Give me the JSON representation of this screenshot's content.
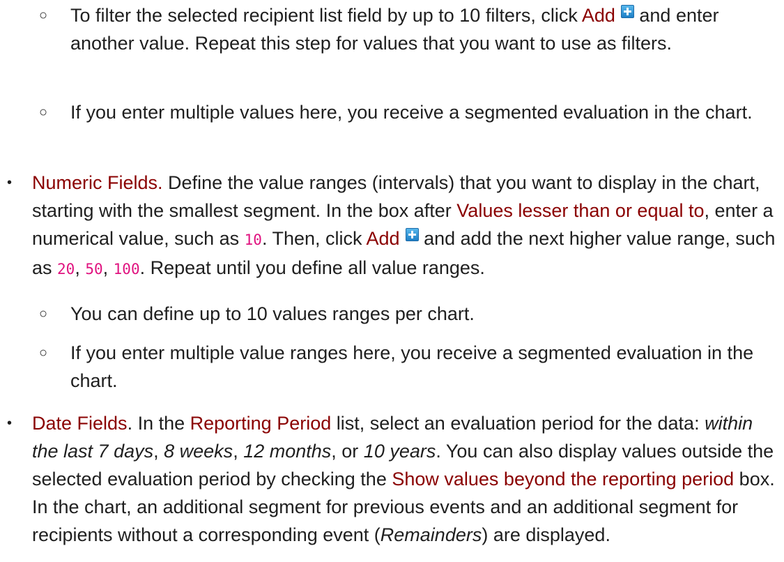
{
  "bullets": {
    "sub": "○",
    "main": "•"
  },
  "icons": {
    "add": "add-icon"
  },
  "colors": {
    "text": "#1f1f1f",
    "ui_term": "#8a0000",
    "code": "#e0127f",
    "add_icon": "#1e7fc6"
  },
  "text": {
    "f1_a": "To filter the selected recipient list field by up to 10 filters, click ",
    "f1_add": "Add",
    "f1_b": " and enter another value. Repeat this step for values that you want to use as filters.",
    "f2": "If you enter multiple values here, you receive a segmented evaluation in the chart.",
    "n_title": "Numeric Fields.",
    "n_a": " Define the value ranges (intervals) that you want to display in the chart, starting with the smallest segment. In the box after ",
    "n_ui": "Values lesser than or equal to",
    "n_b": ", enter a numerical value, such as ",
    "n_v1": "10",
    "n_c": ". Then, click ",
    "n_add": "Add",
    "n_d": " and add the next higher value range, such as ",
    "n_v2": "20",
    "n_sep1": ", ",
    "n_v3": "50",
    "n_sep2": ", ",
    "n_v4": "100",
    "n_e": ". Repeat until you define all value ranges.",
    "n_s1": "You can define up to 10 values ranges per chart.",
    "n_s2": "If you enter multiple value ranges here, you receive a segmented evaluation in the chart.",
    "d_title": "Date Fields",
    "d_a": ". In the ",
    "d_ui1": "Reporting Period",
    "d_b": " list, select an evaluation period for the data: ",
    "d_p1": "within the last 7 days",
    "d_c1": ", ",
    "d_p2": "8 weeks",
    "d_c2": ", ",
    "d_p3": "12 months",
    "d_c3": ", or ",
    "d_p4": "10 years",
    "d_c": ". You can also display values outside the selected evaluation period by checking the ",
    "d_ui2": "Show values beyond the reporting period",
    "d_d": " box. In the chart, an additional segment for previous events and an additional segment for recipients without a corresponding event (",
    "d_rem": "Remainders",
    "d_e": ") are displayed."
  }
}
